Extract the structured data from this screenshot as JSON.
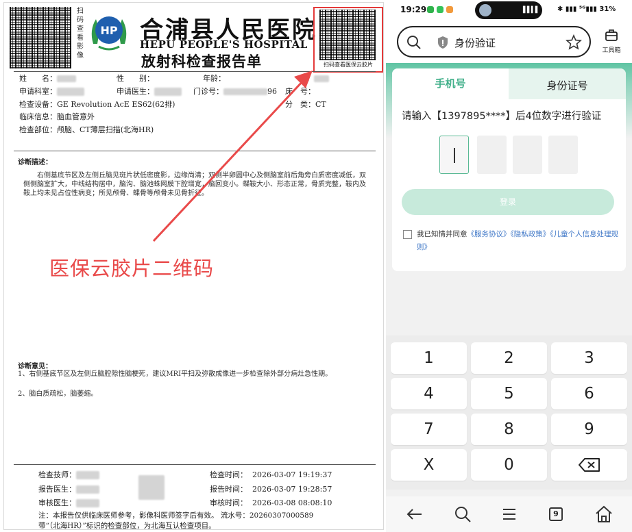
{
  "report": {
    "scan_vertical": "扫码查看影像",
    "hospital_name_cn": "合浦县人民医院",
    "hospital_name_en": "HEPU PEOPLE'S HOSPITAL",
    "title": "放射科检查报告单",
    "qr_caption": "扫码查看医保云胶片",
    "fields": {
      "name_label": "姓　　名：",
      "sex_label": "性　　别：",
      "age_label": "年龄：",
      "no_label": "号：",
      "dept_label": "申请科室：",
      "doctor_label": "申请医生：",
      "outpatient_label": "门诊号：",
      "outpatient_tail": "96",
      "bed_label": "床　号：",
      "device_label": "检查设备：",
      "device_value": "GE Revolution AcE ES62(62排)",
      "category_label": "分　类：",
      "category_value": "CT",
      "clinical_label": "临床信息：",
      "clinical_value": "脑血管意外",
      "part_label": "检查部位：",
      "part_value": "颅脑、CT薄层扫描(北海HR)"
    },
    "diagnosis_heading": "诊断描述：",
    "diagnosis_text": "右侧基底节区及左侧丘脑见斑片状低密度影，边缘尚清；双侧半卵圆中心及侧脑室前后角旁白质密度减低，双侧侧脑室扩大，中线结构居中，脑沟、脑池蛛网膜下腔增宽，脑回变小。蝶鞍大小、形态正常，骨质完整，鞍内及鞍上均未见占位性病变；所见颅骨、蝶骨等颅骨未见骨折征。",
    "annotation_label": "医保云胶片二维码",
    "opinion_heading": "诊断意见：",
    "opinion_1": "1、右侧基底节区及左侧丘脑腔隙性脑梗死，建议MRI平扫及弥散成像进一步检查除外部分病灶急性期。",
    "opinion_2": "2、脑白质疏松，脑萎缩。",
    "signatures": {
      "technician_label": "检查技师：",
      "reporter_label": "报告医生：",
      "reviewer_label": "审核医生：",
      "exam_time_label": "检查时间：",
      "exam_time": "2026-03-07  19:19:37",
      "report_time_label": "报告时间：",
      "report_time": "2026-03-07  19:28:57",
      "review_time_label": "审核时间：",
      "review_time": "2026-03-08  08:08:10"
    },
    "note_1": "注：本报告仅供临床医师参考，影像科医师签字后有效。  流水号：20260307000589",
    "note_2": "带“（北海HR）”标识的检查部位，为北海互认检查项目。",
    "accent_color": "#e94a4a"
  },
  "phone": {
    "status": {
      "time": "19:29",
      "right": "✱ ▮▮▮ ⁵ᴳ▮▮▮ 31%"
    },
    "url_title": "身份验证",
    "toolbox_label": "工具箱",
    "tabs": [
      "手机号",
      "身份证号"
    ],
    "prompt": "请输入【1397895****】后4位数字进行验证",
    "login_label": "登录",
    "agree_prefix": "我已知情并同意",
    "agree_link_1": "《服务协议》",
    "agree_link_2": "《隐私政策》",
    "agree_link_3": "《儿童个人信息处理规则》",
    "keys": [
      "1",
      "2",
      "3",
      "4",
      "5",
      "6",
      "7",
      "8",
      "9",
      "X",
      "0"
    ],
    "nav_page_count": "9",
    "accent_color": "#41b08a"
  }
}
